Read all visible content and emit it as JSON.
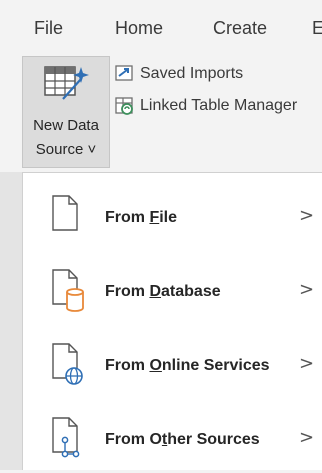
{
  "tabs": [
    {
      "label": "File"
    },
    {
      "label": "Home"
    },
    {
      "label": "Create"
    },
    {
      "label": "E"
    }
  ],
  "ribbon": {
    "new_data_source": {
      "line1": "New Data",
      "line2": "Source",
      "caret": "˅"
    },
    "saved_imports": "Saved Imports",
    "linked_table_manager": "Linked Table Manager"
  },
  "menu": {
    "items": [
      {
        "label_prefix": "From ",
        "label_key": "F",
        "label_rest": "ile",
        "icon": "file-icon",
        "chevron": ">"
      },
      {
        "label_prefix": "From ",
        "label_key": "D",
        "label_rest": "atabase",
        "icon": "database-icon",
        "chevron": ">"
      },
      {
        "label_prefix": "From ",
        "label_key": "O",
        "label_rest": "nline Services",
        "icon": "online-services-icon",
        "chevron": ">"
      },
      {
        "label_prefix": "From O",
        "label_key": "t",
        "label_rest": "her Sources",
        "icon": "other-sources-icon",
        "chevron": ">"
      }
    ]
  },
  "colors": {
    "accent_orange": "#e8893a",
    "accent_blue": "#2f6fb5",
    "accent_green": "#3d8f5c"
  }
}
